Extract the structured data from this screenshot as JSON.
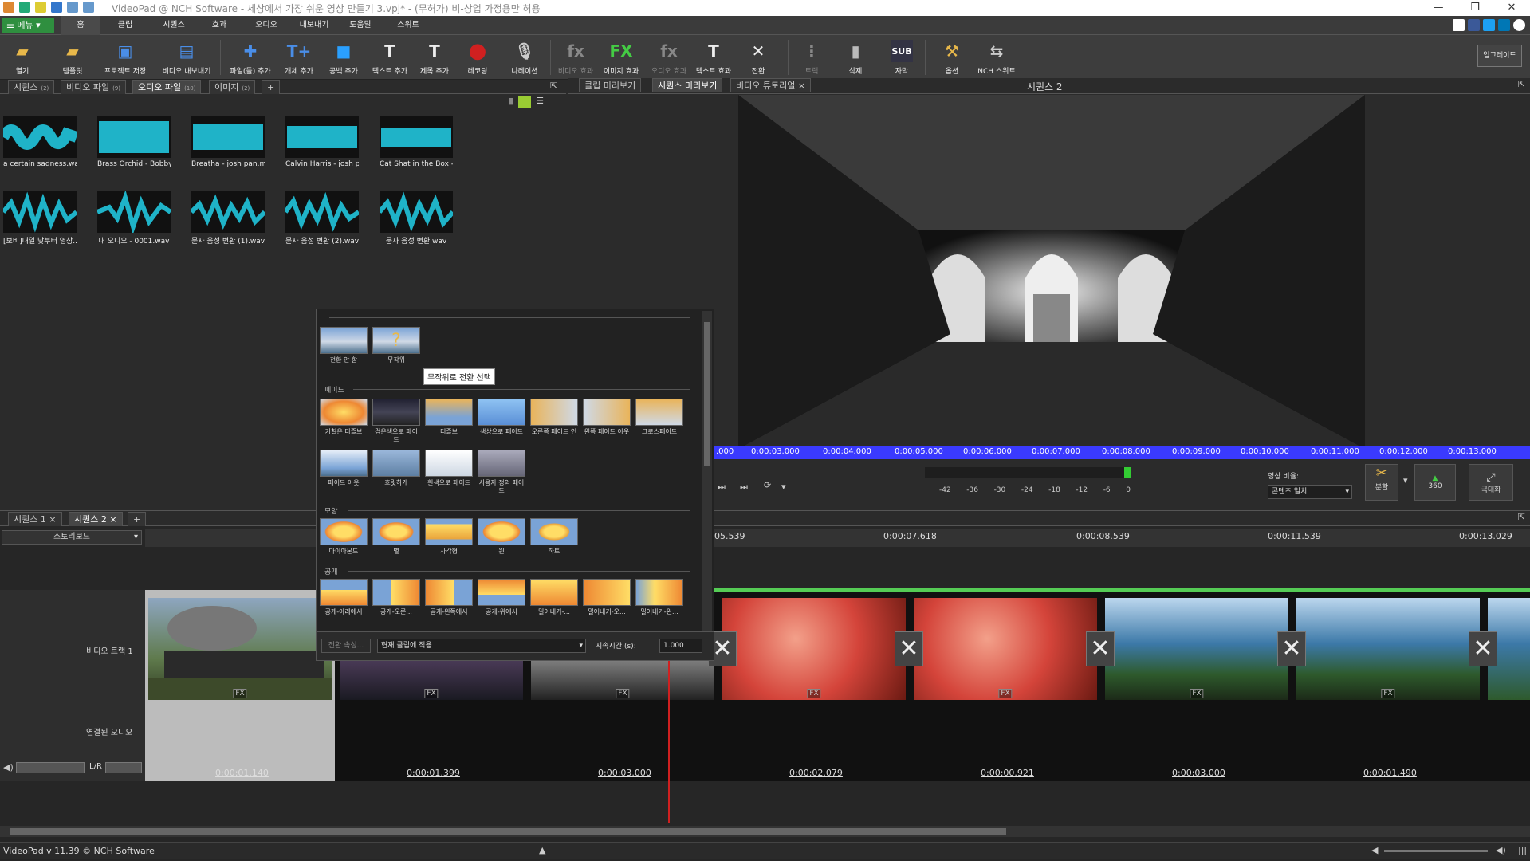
{
  "titlebar": {
    "title": "VideoPad @ NCH Software - 세상에서 가장 쉬운 영상 만들기 3.vpj* - (무허가) 비-상업 가정용만 허용"
  },
  "menu": {
    "menu_button": "메뉴",
    "tabs": [
      "홈",
      "클립",
      "시퀀스",
      "효과",
      "오디오",
      "내보내기",
      "도움말",
      "스위트"
    ]
  },
  "toolbar": {
    "buttons": [
      "열기",
      "템플릿",
      "프로젝트 저장",
      "비디오 내보내기",
      "파일(들) 추가",
      "개체 추가",
      "공백 추가",
      "텍스트 추가",
      "제목 추가",
      "레코딩",
      "나레이션",
      "비디오 효과",
      "이미지 효과",
      "오디오 효과",
      "텍스트 효과",
      "전환",
      "트랙",
      "삭제",
      "자막",
      "옵션",
      "NCH 스위트"
    ],
    "sub_label": "SUB",
    "upgrade": "업그레이드"
  },
  "bin": {
    "tabs": [
      {
        "label": "시퀀스",
        "count": "(2)"
      },
      {
        "label": "비디오 파일",
        "count": "(9)"
      },
      {
        "label": "오디오 파일",
        "count": "(10)"
      },
      {
        "label": "이미지",
        "count": "(2)"
      }
    ],
    "add_tab": "+",
    "items": [
      "a certain sadness.wav",
      "Brass Orchid - Bobby ...",
      "Breatha - josh pan.mp3",
      "Calvin Harris - josh p...",
      "Cat Shat in the Box - j...",
      "[보비]내일 낮부터 영상...",
      "내 오디오 - 0001.wav",
      "문자 음성 변환 (1).wav",
      "문자 음성 변환 (2).wav",
      "문자 음성 변환.wav"
    ]
  },
  "preview": {
    "tabs": [
      "클립 미리보기",
      "시퀀스 미리보기",
      "비디오 튜토리얼"
    ],
    "title": "시퀀스 2",
    "ruler": [
      "0:00:03.000",
      "0:00:04.000",
      "0:00:05.000",
      "0:00:06.000",
      "0:00:07.000",
      "0:00:08.000",
      "0:00:09.000",
      "0:00:10.000",
      "0:00:11.000",
      "0:00:12.000",
      "0:00:13.000"
    ],
    "ruler_start": ".000",
    "meter_labels": [
      "-42",
      "-36",
      "-30",
      "-24",
      "-18",
      "-12",
      "-6",
      "0"
    ],
    "aspect_label": "영상 비율:",
    "aspect_value": "콘텐츠 일치",
    "split": "분할",
    "vr": "360",
    "fullscreen": "극대화"
  },
  "transitions": {
    "row0": [
      "전환 안 함",
      "무작위"
    ],
    "tooltip": "무작위로 전환 선택",
    "sections": [
      "페이드",
      "모양",
      "공개"
    ],
    "fade": [
      "거칠은 디졸브",
      "검은색으로 페이드",
      "디졸브",
      "색상으로 페이드",
      "오른쪽 페이드 인",
      "왼쪽 페이드 아웃",
      "크로스페이드",
      "페이드 아웃",
      "흐릿하게",
      "흰색으로 페이드",
      "사용자 정의 페이드"
    ],
    "shape": [
      "다이아몬드",
      "별",
      "사각형",
      "원",
      "하트"
    ],
    "reveal": [
      "공개-아래에서",
      "공개-오른...",
      "공개-왼쪽에서",
      "공개-위에서",
      "밀어내기-...",
      "밀어내기-오...",
      "밀어내기-왼..."
    ],
    "props_button": "전환 속성...",
    "apply": "현재 클립에 적용",
    "duration_label": "지속시간 (s):",
    "duration_value": "1.000"
  },
  "timeline": {
    "seq_tabs": [
      "시퀀스 1",
      "시퀀스 2"
    ],
    "add_tab": "+",
    "mode": "스토리보드",
    "ruler": [
      "05.539",
      "0:00:07.618",
      "0:00:08.539",
      "0:00:11.539",
      "0:00:13.029"
    ],
    "video_track": "비디오 트랙 1",
    "linked_audio": "연결된 오디오",
    "lr": "L/R",
    "fx": "FX",
    "durations": [
      "0:00:01.140",
      "0:00:01.399",
      "0:00:03.000",
      "0:00:02.079",
      "0:00:00.921",
      "0:00:03.000",
      "0:00:01.490"
    ]
  },
  "status": {
    "text": "VideoPad v 11.39 © NCH Software"
  },
  "colors": {
    "accent_green": "#2f8f3f",
    "ruler_blue": "#3a3aff",
    "playhead": "#d02020",
    "sel_green": "#5c5"
  }
}
